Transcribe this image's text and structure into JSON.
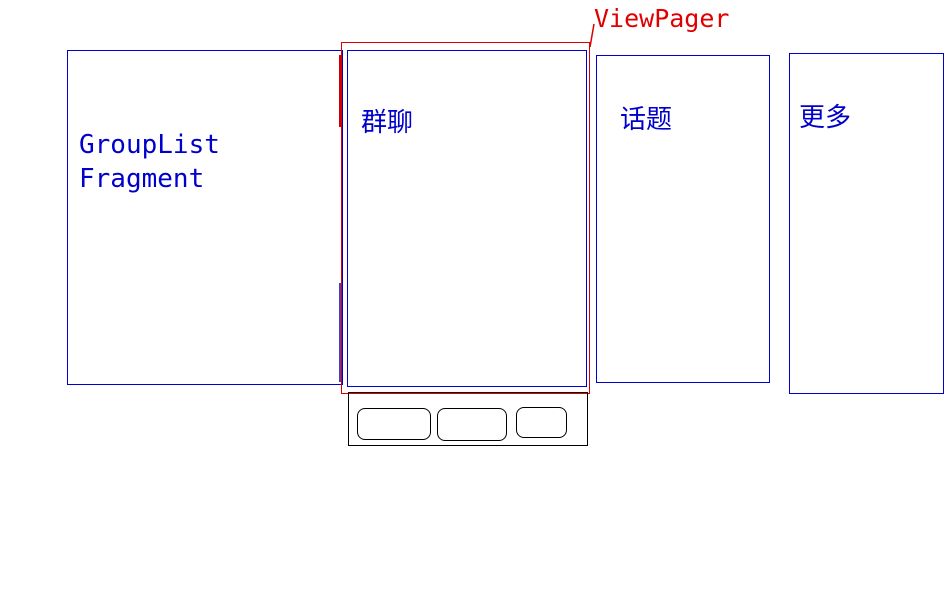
{
  "labels": {
    "viewpager": "ViewPager",
    "grouplist_fragment": "GroupList\nFragment",
    "page_qunliao": "群聊",
    "page_huati": "话题",
    "page_gengduo": "更多"
  },
  "colors": {
    "blue": "#0000cc",
    "red": "#dd0000",
    "black": "#000000",
    "background": "#ffffff"
  }
}
